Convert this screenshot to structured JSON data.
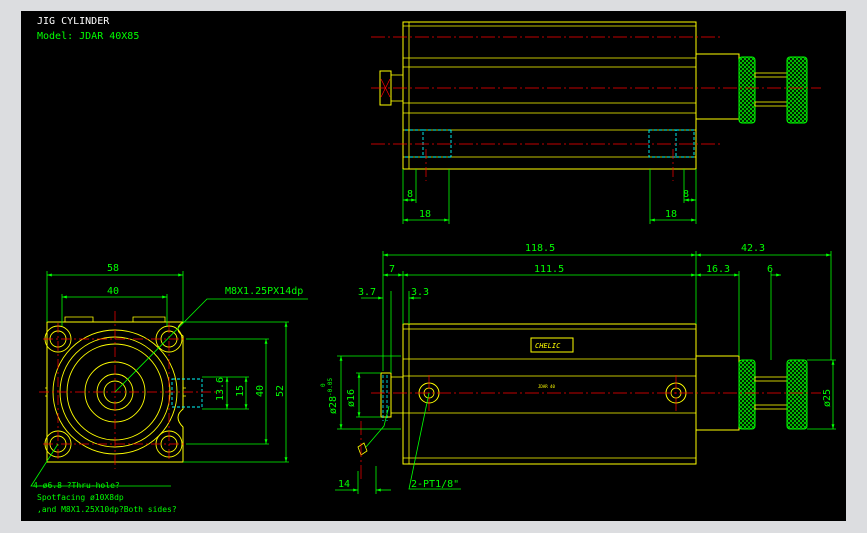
{
  "title": {
    "line1": "JIG CYLINDER",
    "line2": "Model:  JDAR 40X85"
  },
  "top_view": {
    "dim_left_small": "8",
    "dim_left_big": "18",
    "dim_right_small": "8",
    "dim_right_big": "18"
  },
  "front_view": {
    "dim_58": "58",
    "dim_40_h": "40",
    "dim_13_6": "13.6",
    "dim_15": "15",
    "dim_40_v": "40",
    "dim_52": "52",
    "thread_note": "M8X1.25PX14dp",
    "hole_note_1": "4-ø6.8 ?Thru-hole?",
    "hole_note_2": "Spotfacing  ø10X8dp",
    "hole_note_3": ",and M8X1.25X10dp?Both sides?"
  },
  "side_view": {
    "dim_118_5": "118.5",
    "dim_42_3": "42.3",
    "dim_7": "7",
    "dim_111_5": "111.5",
    "dim_16_3": "16.3",
    "dim_6": "6",
    "dim_3_7": "3.7",
    "dim_3_3": "3.3",
    "dim_phi28": "ø28",
    "dim_phi28_tol_top": "0",
    "dim_phi28_tol_bot": "-0.05",
    "dim_phi16": "ø16",
    "dim_phi25": "ø25",
    "dim_14": "14",
    "port_note": "2-PT1/8\"",
    "brand_label": "CHELIC",
    "small_label": "JDAR 40"
  },
  "colors": {
    "outline": "#ffff00",
    "dimension": "#00ff00",
    "centerline": "#ff0000",
    "hidden": "#00ffff",
    "text": "#ffffff"
  }
}
